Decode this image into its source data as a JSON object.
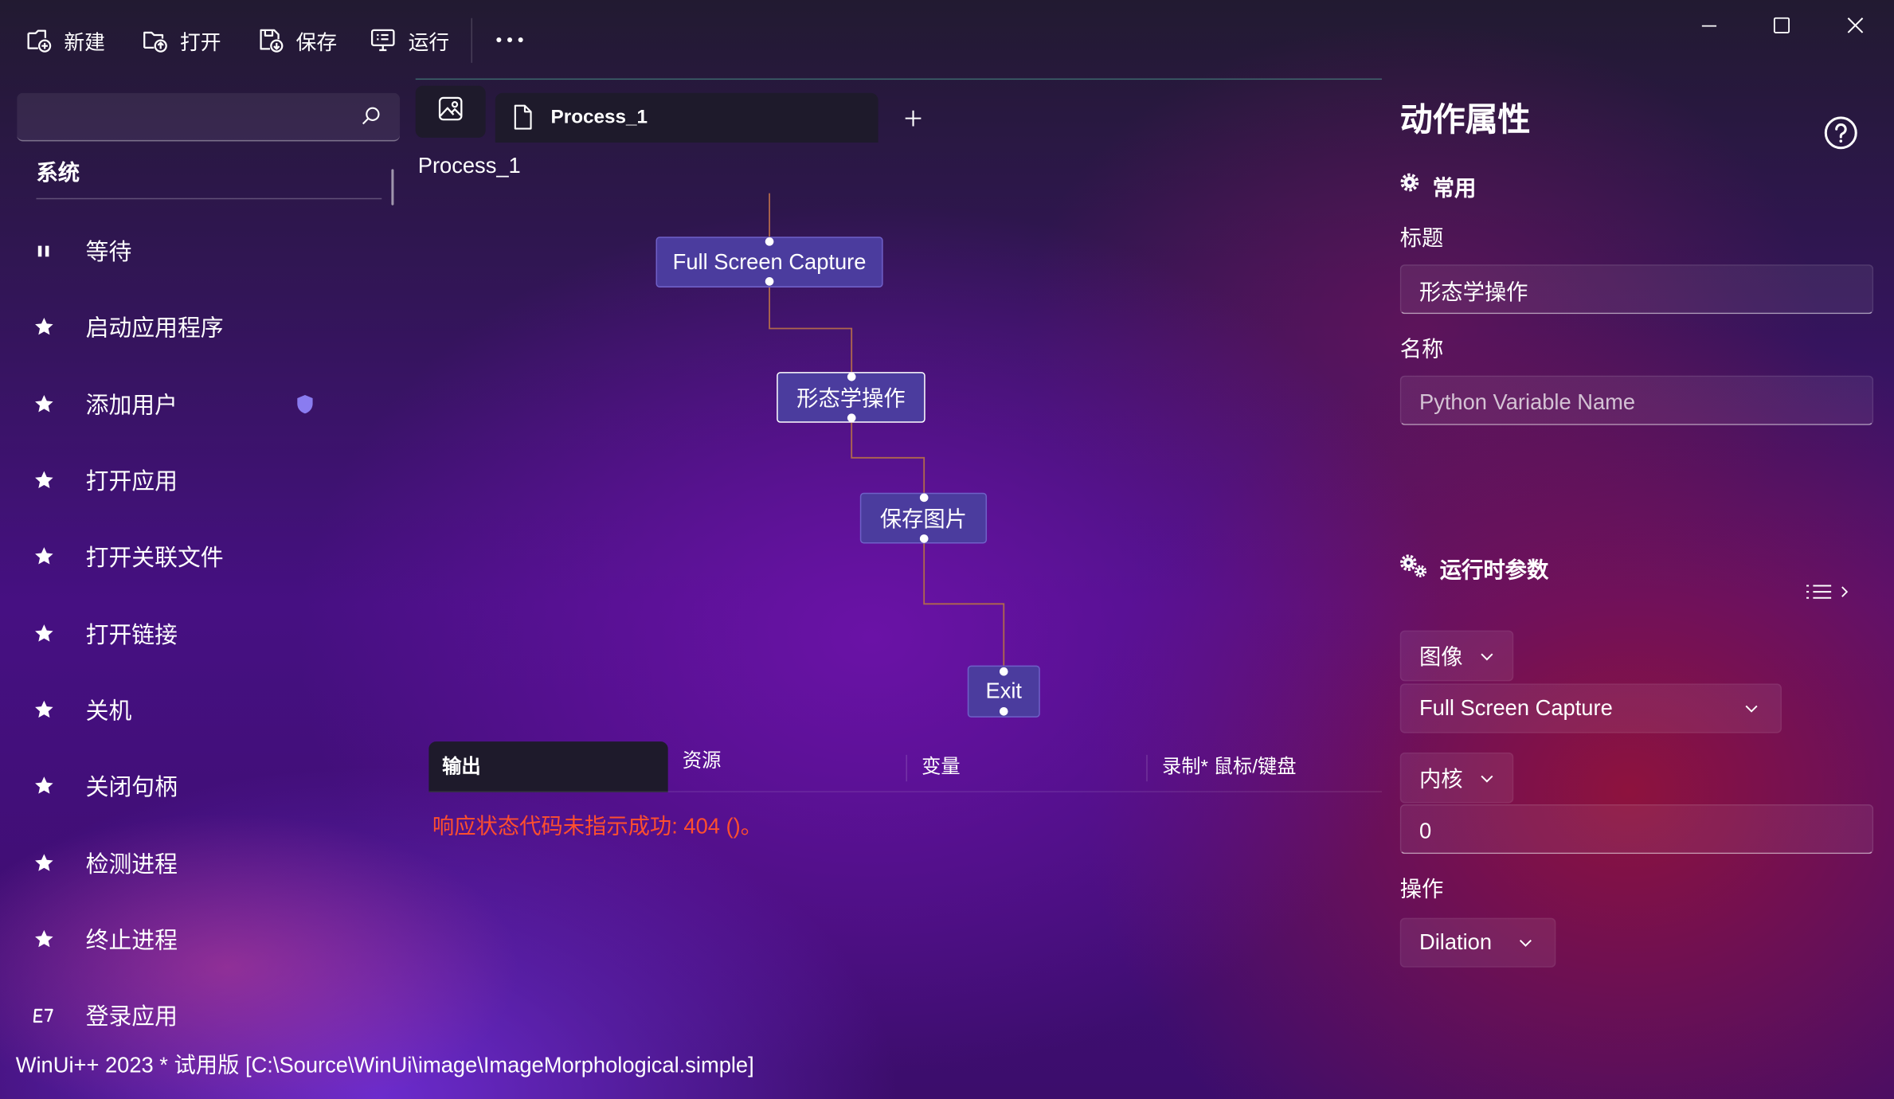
{
  "toolbar": {
    "new_label": "新建",
    "open_label": "打开",
    "save_label": "保存",
    "run_label": "运行",
    "new_icon": "new-file-icon",
    "open_icon": "open-folder-icon",
    "save_icon": "save-icon",
    "run_icon": "run-monitor-icon",
    "more_icon": "more-icon"
  },
  "window_controls": [
    "minimize-icon",
    "maximize-icon",
    "close-icon"
  ],
  "sidebar": {
    "search_icon": "search-icon",
    "section_title": "系统",
    "items": [
      {
        "label": "等待",
        "icon": "pause-icon"
      },
      {
        "label": "启动应用程序",
        "icon": "star-icon"
      },
      {
        "label": "添加用户",
        "icon": "star-icon",
        "badge": "shield-icon"
      },
      {
        "label": "打开应用",
        "icon": "star-icon"
      },
      {
        "label": "打开关联文件",
        "icon": "star-icon"
      },
      {
        "label": "打开链接",
        "icon": "star-icon"
      },
      {
        "label": "关机",
        "icon": "star-icon"
      },
      {
        "label": "关闭句柄",
        "icon": "star-icon"
      },
      {
        "label": "检测进程",
        "icon": "star-icon"
      },
      {
        "label": "终止进程",
        "icon": "star-icon"
      },
      {
        "label": "登录应用",
        "icon": "login-icon"
      }
    ]
  },
  "editor": {
    "image_tab_icon": "image-icon",
    "tabs": [
      {
        "label": "Process_1",
        "icon": "file-icon"
      }
    ],
    "add_tab_icon": "plus-icon",
    "canvas_title": "Process_1",
    "flow": {
      "nodes": [
        {
          "label": "Full Screen Capture"
        },
        {
          "label": "形态学操作",
          "selected": true
        },
        {
          "label": "保存图片"
        },
        {
          "label": "Exit"
        }
      ],
      "edges": [
        [
          "Full Screen Capture",
          "形态学操作"
        ],
        [
          "形态学操作",
          "保存图片"
        ],
        [
          "保存图片",
          "Exit"
        ]
      ]
    }
  },
  "output": {
    "tabs": [
      {
        "label": "输出",
        "active": true
      },
      {
        "label": "资源"
      },
      {
        "label": "变量"
      },
      {
        "label": "录制* 鼠标/键盘"
      }
    ],
    "messages": [
      "响应状态代码未指示成功: 404 ()。"
    ]
  },
  "properties": {
    "title": "动作属性",
    "help_icon": "help-icon",
    "common": {
      "label": "常用",
      "icon": "gear-icon",
      "title_label": "标题",
      "title_value": "形态学操作",
      "name_label": "名称",
      "name_placeholder": "Python Variable Name"
    },
    "runtime": {
      "label": "运行时参数",
      "icon": "gears-icon",
      "list_icon": "list-icon",
      "image_label": "图像",
      "image_value": "Full Screen Capture",
      "kernel_label": "内核",
      "kernel_value": "0",
      "operation_label": "操作",
      "operation_value": "Dilation"
    }
  },
  "status_bar": {
    "text": "WinUi++ 2023 * 试用版 [C:\\Source\\WinUi\\image\\ImageMorphological.simple]"
  },
  "colors": {
    "node_fill": "#4b3c9e",
    "node_border": "#6f60c8",
    "connector": "#b0684c",
    "error_text": "#ff4f2e",
    "panel_dark": "#1e1a2b",
    "shield_badge": "#8a7cf0"
  }
}
